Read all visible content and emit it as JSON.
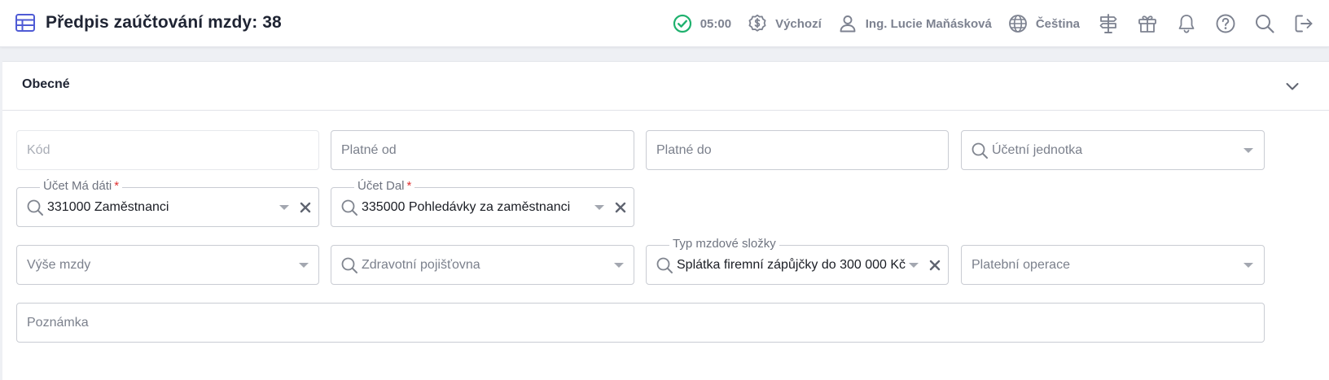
{
  "header": {
    "title": "Předpis zaúčtování mzdy: 38",
    "time": "05:00",
    "currency_profile": "Výchozí",
    "user": "Ing. Lucie Maňásková",
    "language": "Čeština"
  },
  "section": {
    "title": "Obecné"
  },
  "form": {
    "kod": {
      "placeholder": "Kód"
    },
    "platne_od": {
      "placeholder": "Platné od"
    },
    "platne_do": {
      "placeholder": "Platné do"
    },
    "ucetni_jednotka": {
      "placeholder": "Účetní jednotka"
    },
    "ucet_ma_dati": {
      "label": "Účet Má dáti",
      "required": "*",
      "value": "331000 Zaměstnanci"
    },
    "ucet_dal": {
      "label": "Účet Dal",
      "required": "*",
      "value": "335000 Pohledávky za zaměstnanci"
    },
    "vyse_mzdy": {
      "placeholder": "Výše mzdy"
    },
    "zdravotni_pojistovna": {
      "placeholder": "Zdravotní pojišťovna"
    },
    "typ_mzdove_slozky": {
      "label": "Typ mzdové složky",
      "value": "Splátka firemní zápůjčky do 300 000 Kč"
    },
    "platebni_operace": {
      "placeholder": "Platební operace"
    },
    "poznamka": {
      "placeholder": "Poznámka"
    }
  },
  "colors": {
    "accent": "#4f5bd5",
    "status_ok": "#1fb16e",
    "header_icon": "#7d8290"
  }
}
